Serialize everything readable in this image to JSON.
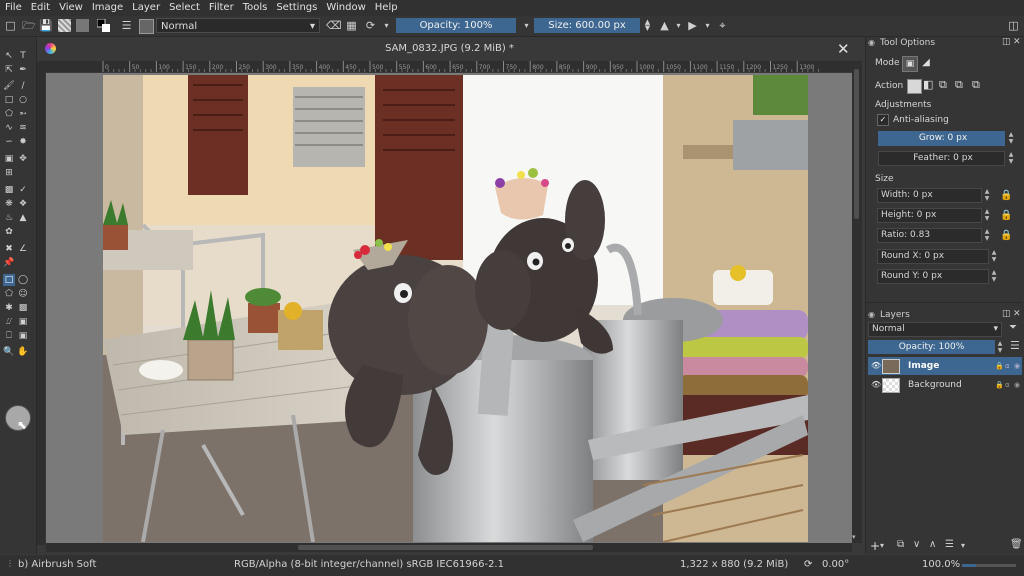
{
  "menu": [
    "File",
    "Edit",
    "View",
    "Image",
    "Layer",
    "Select",
    "Filter",
    "Tools",
    "Settings",
    "Window",
    "Help"
  ],
  "toolbar": {
    "blend_mode": "Normal",
    "opacity_label": "Opacity: 100%",
    "size_label": "Size: 600.00 px",
    "opacity_fraction": 1.0
  },
  "document": {
    "title": "SAM_0832.JPG (9.2 MiB) *"
  },
  "ruler_ticks": [
    "0",
    "50",
    "100",
    "150",
    "200",
    "250",
    "300",
    "350",
    "400",
    "450",
    "500",
    "550",
    "600",
    "650",
    "700",
    "750",
    "800",
    "850",
    "900",
    "950",
    "1000",
    "1050",
    "1100",
    "1150",
    "1200",
    "1250",
    "1300"
  ],
  "tool_options": {
    "title": "Tool Options",
    "mode_label": "Mode",
    "action_label": "Action",
    "adjustments_label": "Adjustments",
    "antialiasing_label": "Anti-aliasing",
    "grow_label": "Grow: 0 px",
    "feather_label": "Feather: 0 px",
    "size_label": "Size",
    "width_label": "Width: 0 px",
    "height_label": "Height: 0 px",
    "ratio_label": "Ratio: 0.83",
    "round_x_label": "Round X: 0 px",
    "round_y_label": "Round Y: 0 px"
  },
  "layers": {
    "title": "Layers",
    "blend_mode": "Normal",
    "opacity_label": "Opacity: 100%",
    "items": [
      {
        "name": "Image",
        "selected": true
      },
      {
        "name": "Background",
        "selected": false
      }
    ]
  },
  "status": {
    "brush": "b) Airbrush Soft",
    "color_space": "RGB/Alpha (8-bit integer/channel)  sRGB IEC61966-2.1",
    "dimensions": "1,322 x 880 (9.2 MiB)",
    "rotation": "0.00°",
    "zoom": "100.0%"
  },
  "colors": {
    "accent": "#3d6790",
    "background": "#353535",
    "selected_layer": "#3d6790"
  }
}
